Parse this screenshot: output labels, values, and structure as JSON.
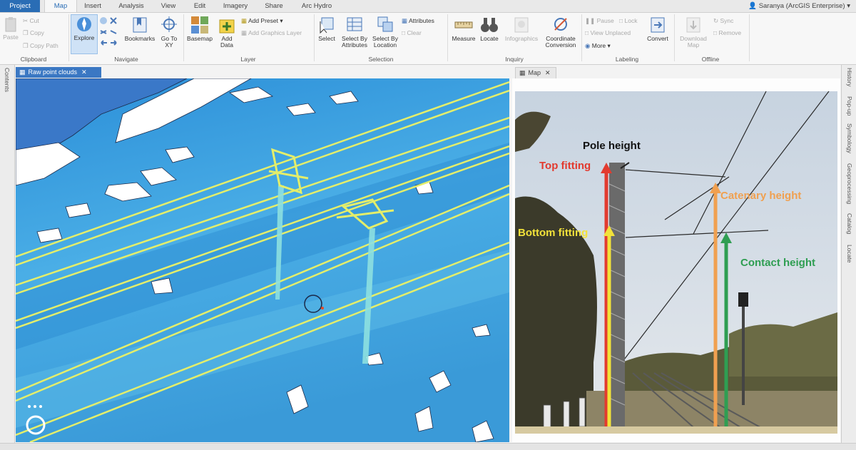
{
  "ribbon_tabs": [
    "Project",
    "Map",
    "Insert",
    "Analysis",
    "View",
    "Edit",
    "Imagery",
    "Share",
    "Arc Hydro"
  ],
  "user": "Saranya (ArcGIS Enterprise) ▾",
  "clipboard": {
    "paste": "Paste",
    "cut": "Cut",
    "copy": "Copy",
    "copy_path": "Copy Path",
    "group": "Clipboard"
  },
  "navigate": {
    "explore": "Explore",
    "bookmarks": "Bookmarks",
    "goto": "Go To XY",
    "group": "Navigate"
  },
  "layer": {
    "basemap": "Basemap",
    "add_data": "Add Data",
    "add_preset": "Add Preset",
    "add_graphics": "Add Graphics Layer",
    "group": "Layer"
  },
  "selection": {
    "select": "Select",
    "select_by_attr": "Select By Attributes",
    "select_by_loc": "Select By Location",
    "attributes": "Attributes",
    "clear": "Clear",
    "group": "Selection"
  },
  "inquiry": {
    "measure": "Measure",
    "locate": "Locate",
    "infographics": "Infographics",
    "coord": "Coordinate Conversion",
    "group": "Inquiry"
  },
  "labeling": {
    "pause": "Pause",
    "lock": "Lock",
    "view_unplaced": "View Unplaced",
    "more": "More",
    "convert": "Convert",
    "group": "Labeling"
  },
  "offline": {
    "download": "Download Map",
    "sync": "Sync",
    "remove": "Remove",
    "group": "Offline"
  },
  "left_pane": {
    "contents": "Contents"
  },
  "right_pane": [
    "History",
    "Pop-up",
    "Symbology",
    "Geoprocessing",
    "Catalog",
    "Locate"
  ],
  "views": {
    "left_tab": "Raw point clouds",
    "right_tab": "Map"
  },
  "annotations": {
    "pole_height": "Pole height",
    "top_fitting": "Top fitting",
    "bottom_fitting": "Bottom fitting",
    "catenary_height": "Catenary height",
    "contact_height": "Contact height"
  },
  "colors": {
    "project_tab": "#2a6db5",
    "point_cloud_blue": "#3ba3e2",
    "feature_yellow": "#e4ee6a",
    "top_fitting": "#e23b2f",
    "bottom_fitting": "#f2e23a",
    "catenary": "#f0a050",
    "contact": "#2f9e52"
  }
}
